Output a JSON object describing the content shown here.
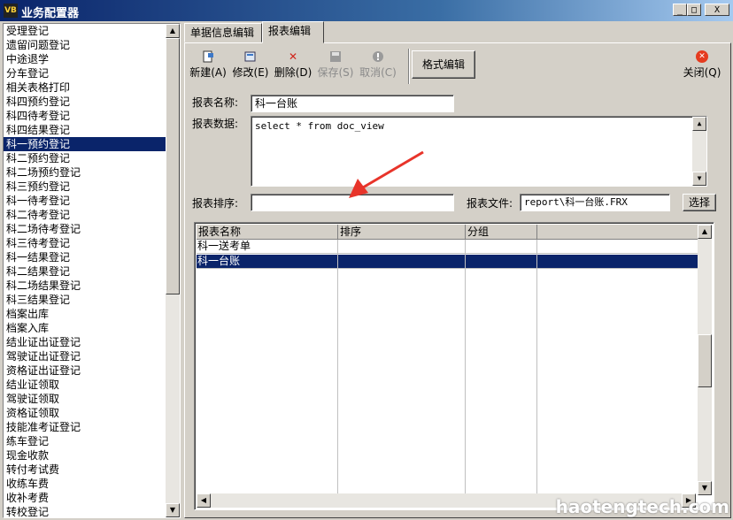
{
  "window": {
    "title": "业务配置器",
    "app_icon": "VB",
    "min_btn": "_",
    "max_btn": "□",
    "close_btn": "X"
  },
  "sidebar": {
    "items": [
      {
        "label": "受理登记"
      },
      {
        "label": "遗留问题登记"
      },
      {
        "label": "中途退学"
      },
      {
        "label": "分车登记"
      },
      {
        "label": "相关表格打印"
      },
      {
        "label": "科四预约登记"
      },
      {
        "label": "科四待考登记"
      },
      {
        "label": "科四结果登记"
      },
      {
        "label": "科一预约登记",
        "selected": true
      },
      {
        "label": "科二预约登记"
      },
      {
        "label": "科二场预约登记"
      },
      {
        "label": "科三预约登记"
      },
      {
        "label": "科一待考登记"
      },
      {
        "label": "科二待考登记"
      },
      {
        "label": "科二场待考登记"
      },
      {
        "label": "科三待考登记"
      },
      {
        "label": "科一结果登记"
      },
      {
        "label": "科二结果登记"
      },
      {
        "label": "科二场结果登记"
      },
      {
        "label": "科三结果登记"
      },
      {
        "label": "档案出库"
      },
      {
        "label": "档案入库"
      },
      {
        "label": "结业证出证登记"
      },
      {
        "label": "驾驶证出证登记"
      },
      {
        "label": "资格证出证登记"
      },
      {
        "label": "结业证领取"
      },
      {
        "label": "驾驶证领取"
      },
      {
        "label": "资格证领取"
      },
      {
        "label": "技能准考证登记"
      },
      {
        "label": "练车登记"
      },
      {
        "label": "现金收款"
      },
      {
        "label": "转付考试费"
      },
      {
        "label": "收练车费"
      },
      {
        "label": "收补考费"
      },
      {
        "label": "转校登记"
      }
    ]
  },
  "tabs": [
    {
      "label": "单据信息编辑"
    },
    {
      "label": "报表编辑",
      "active": true
    }
  ],
  "toolbar": {
    "new": "新建(A)",
    "edit": "修改(E)",
    "delete": "删除(D)",
    "save": "保存(S)",
    "cancel": "取消(C)",
    "format_edit": "格式编辑",
    "close": "关闭(Q)"
  },
  "form": {
    "report_name_label": "报表名称:",
    "report_name_value": "科一台账",
    "report_data_label": "报表数据:",
    "report_data_value": "select * from doc_view",
    "report_sort_label": "报表排序:",
    "report_sort_value": "",
    "report_file_label": "报表文件:",
    "report_file_value": "report\\科一台账.FRX",
    "choose_button": "选择"
  },
  "grid": {
    "columns": [
      "报表名称",
      "排序",
      "分组"
    ],
    "rows": [
      {
        "name": "科一送考单",
        "sort": "",
        "group": ""
      },
      {
        "name": "科一台账",
        "sort": "",
        "group": "",
        "selected": true
      }
    ]
  },
  "watermark": "haotengtech.com",
  "colors": {
    "selection": "#0a246a",
    "face": "#d4d0c8",
    "close_icon": "#e53b1f",
    "arrow": "#e8342a"
  }
}
